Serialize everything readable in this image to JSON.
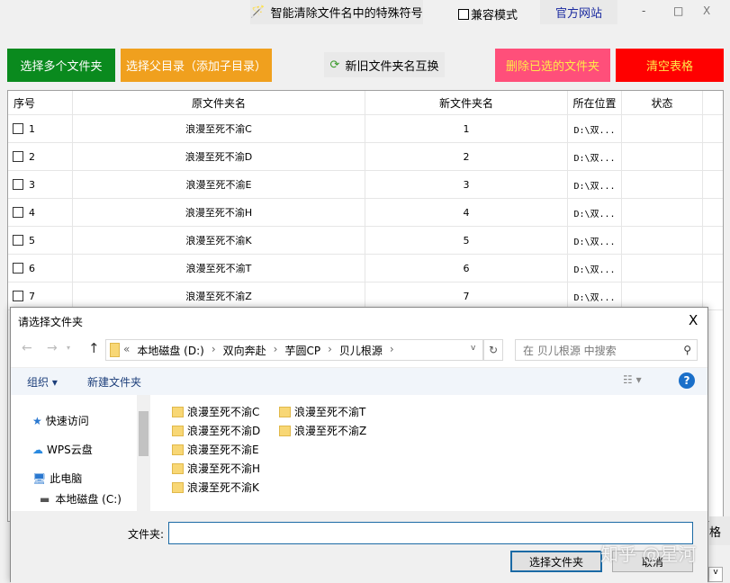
{
  "topbar": {
    "clean_label": "智能清除文件名中的特殊符号",
    "compat_label": "兼容模式",
    "website_label": "官方网站",
    "minimize": "-",
    "maximize": "□",
    "close": "X"
  },
  "buttons": {
    "select_multi": "选择多个文件夹",
    "select_parent": "选择父目录（添加子目录）",
    "swap": "新旧文件夹名互换",
    "delete_selected": "删除已选的文件夹",
    "clear_table": "清空表格"
  },
  "colors": {
    "green": "#0a8a1e",
    "orange": "#f0a01e",
    "pink": "#ff4f7a",
    "red": "#ff0000"
  },
  "table": {
    "headers": [
      "序号",
      "原文件夹名",
      "新文件夹名",
      "所在位置",
      "状态"
    ],
    "rows": [
      {
        "no": "1",
        "orig": "浪漫至死不渝C",
        "new": "1",
        "loc": "D:\\双...",
        "status": ""
      },
      {
        "no": "2",
        "orig": "浪漫至死不渝D",
        "new": "2",
        "loc": "D:\\双...",
        "status": ""
      },
      {
        "no": "3",
        "orig": "浪漫至死不渝E",
        "new": "3",
        "loc": "D:\\双...",
        "status": ""
      },
      {
        "no": "4",
        "orig": "浪漫至死不渝H",
        "new": "4",
        "loc": "D:\\双...",
        "status": ""
      },
      {
        "no": "5",
        "orig": "浪漫至死不渝K",
        "new": "5",
        "loc": "D:\\双...",
        "status": ""
      },
      {
        "no": "6",
        "orig": "浪漫至死不渝T",
        "new": "6",
        "loc": "D:\\双...",
        "status": ""
      },
      {
        "no": "7",
        "orig": "浪漫至死不渝Z",
        "new": "7",
        "loc": "D:\\双...",
        "status": ""
      }
    ]
  },
  "behind": {
    "partial_label": "格"
  },
  "dialog": {
    "title": "请选择文件夹",
    "close": "X",
    "path": [
      "«",
      "本地磁盘 (D:)",
      "›",
      "双向奔赴",
      "›",
      "芋圆CP",
      "›",
      "贝儿根源",
      "›"
    ],
    "search_placeholder": "在 贝儿根源 中搜索",
    "organize": "组织 ▾",
    "new_folder": "新建文件夹",
    "help": "?",
    "nav": [
      "快速访问",
      "WPS云盘",
      "此电脑",
      "本地磁盘 (C:)"
    ],
    "files": [
      "浪漫至死不渝C",
      "浪漫至死不渝D",
      "浪漫至死不渝E",
      "浪漫至死不渝H",
      "浪漫至死不渝K",
      "浪漫至死不渝T",
      "浪漫至死不渝Z"
    ],
    "folder_label": "文件夹:",
    "folder_value": "",
    "select_button": "选择文件夹",
    "cancel_button": "取消"
  },
  "watermark": "知乎 @星河"
}
